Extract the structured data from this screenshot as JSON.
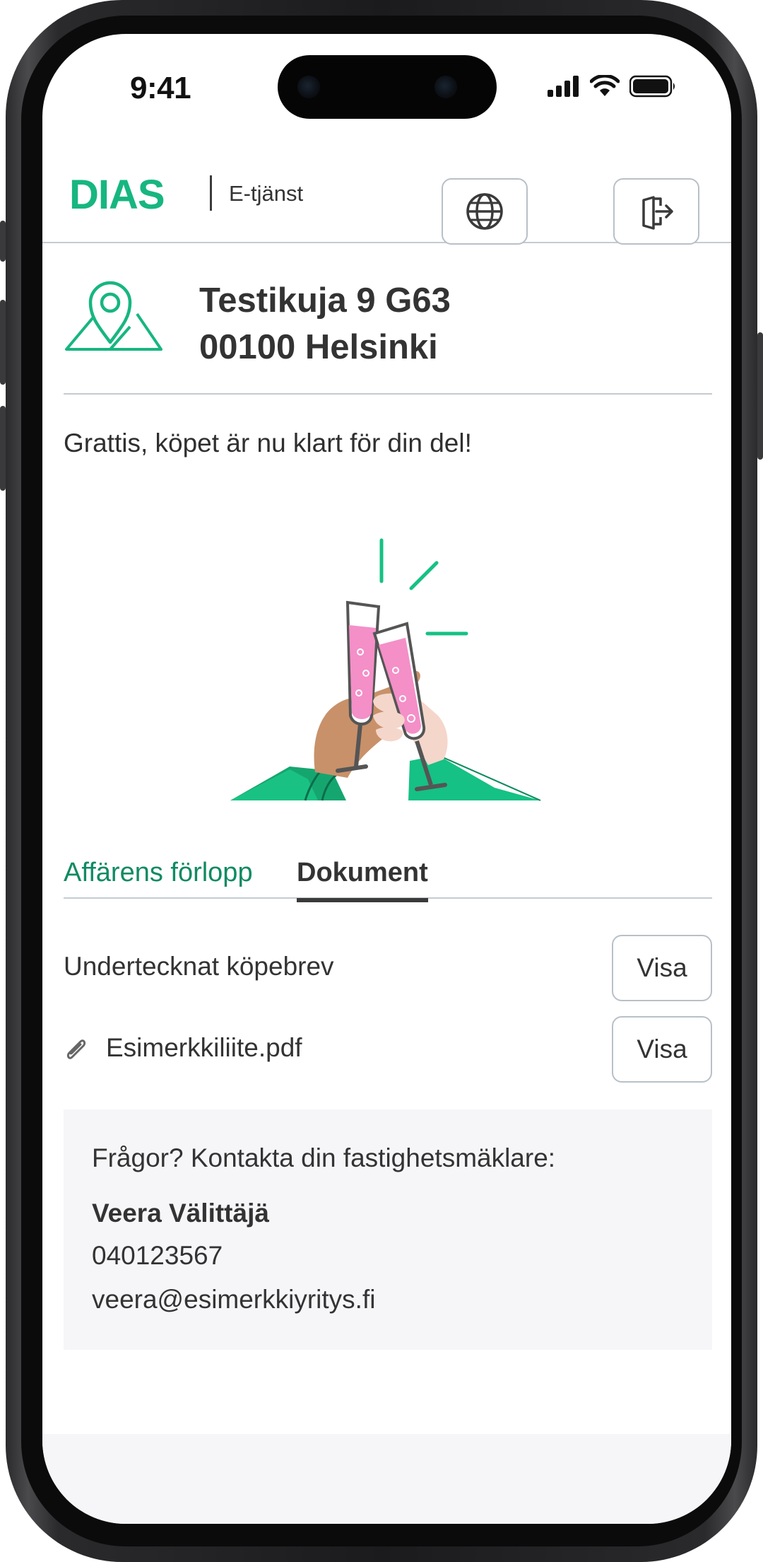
{
  "status_bar": {
    "time": "9:41"
  },
  "header": {
    "logo": "DIAS",
    "service": "E-tjänst"
  },
  "address": {
    "line1": "Testikuja 9 G63",
    "line2": "00100 Helsinki"
  },
  "message": "Grattis, köpet är nu klart för din del!",
  "tabs": [
    {
      "label": "Affärens förlopp",
      "active": false
    },
    {
      "label": "Dokument",
      "active": true
    }
  ],
  "documents": [
    {
      "label": "Undertecknat köpebrev",
      "button": "Visa",
      "attachment": false
    },
    {
      "label": "Esimerkkiliite.pdf",
      "button": "Visa",
      "attachment": true
    }
  ],
  "contact": {
    "question": "Frågor? Kontakta din fastighetsmäklare:",
    "name": "Veera Välittäjä",
    "phone": "040123567",
    "email": "veera@esimerkkiyritys.fi"
  },
  "colors": {
    "brand": "#17b680",
    "tab_active_link": "#118a63",
    "drink": "#f48fc8",
    "sleeve": "#15c184"
  },
  "icons": [
    "location-pin-icon",
    "globe-icon",
    "logout-icon",
    "paperclip-icon"
  ]
}
